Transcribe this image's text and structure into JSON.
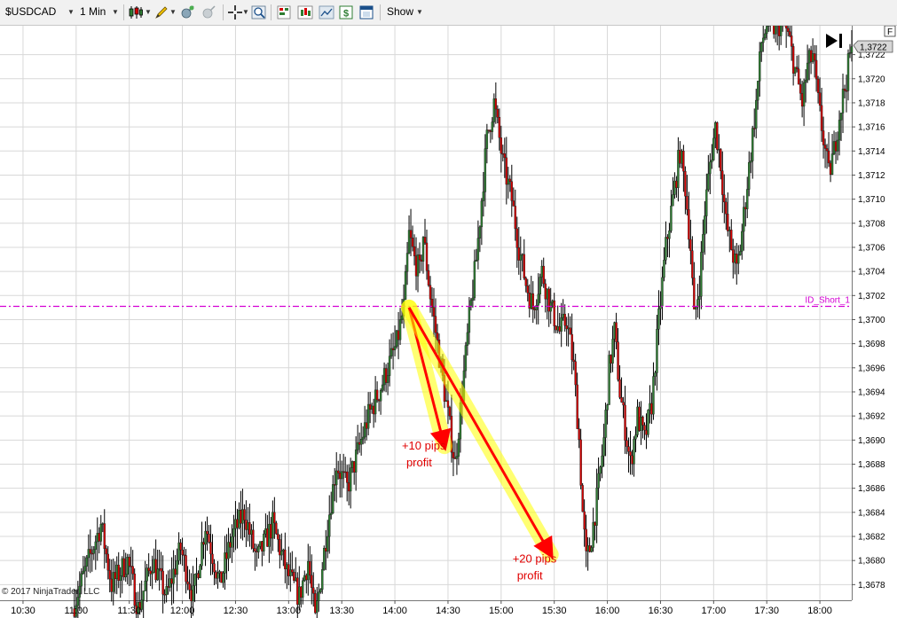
{
  "toolbar": {
    "instrument": "$USDCAD",
    "interval": "1 Min",
    "show_label": "Show",
    "icons": [
      "candlestick-style-icon",
      "pencil-draw-icon",
      "add-indicator-icon",
      "remove-indicator-icon",
      "crosshair-icon",
      "zoom-icon",
      "strategies-icon",
      "data-series-icon",
      "chart-properties-icon",
      "order-entry-icon",
      "window-icon"
    ]
  },
  "copyright": "© 2017 NinjaTrader, LLC",
  "price_marker": "1,3722",
  "corner_tag": "F",
  "colors": {
    "up_candle": "#2e7d32",
    "down_candle": "#d50000",
    "wick": "#000000",
    "level_line": "#d400d4",
    "highlight": "#ffff00",
    "arrow": "#ff0000",
    "annotation_text": "#e00000",
    "grid": "#d8d8d8"
  },
  "chart_data": {
    "type": "candlestick",
    "symbol": "$USDCAD",
    "timeframe": "1 Min",
    "x_tick_labels": [
      "10:30",
      "11:00",
      "11:30",
      "12:00",
      "12:30",
      "13:00",
      "13:30",
      "14:00",
      "14:30",
      "15:00",
      "15:30",
      "16:00",
      "16:30",
      "17:00",
      "17:30",
      "18:00"
    ],
    "y_tick_labels": [
      "1,3678",
      "1,3680",
      "1,3682",
      "1,3684",
      "1,3686",
      "1,3688",
      "1,3690",
      "1,3692",
      "1,3694",
      "1,3696",
      "1,3698",
      "1,3700",
      "1,3702",
      "1,3704",
      "1,3706",
      "1,3708",
      "1,3710",
      "1,3712",
      "1,3714",
      "1,3716",
      "1,3718",
      "1,3720",
      "1,3722"
    ],
    "ylim": [
      1.36767,
      1.37244
    ],
    "x_range_minutes": [
      617,
      1098
    ],
    "grid": true,
    "last_price": 1.3722,
    "level_line": {
      "label": "ID_Short_1",
      "price": 1.37011
    },
    "annotations": [
      {
        "text": [
          "+10 pips",
          "profit"
        ],
        "from": {
          "time": "14:08",
          "price": 1.3701
        },
        "to": {
          "time": "14:28",
          "price": 1.36895
        }
      },
      {
        "text": [
          "+20 pips",
          "profit"
        ],
        "from": {
          "time": "14:08",
          "price": 1.3701
        },
        "to": {
          "time": "15:28",
          "price": 1.36805
        }
      }
    ],
    "price_path": [
      [
        659,
        1.3676
      ],
      [
        668,
        1.368
      ],
      [
        675,
        1.3683
      ],
      [
        681,
        1.3678
      ],
      [
        690,
        1.368
      ],
      [
        696,
        1.3676
      ],
      [
        704,
        1.368
      ],
      [
        712,
        1.3677
      ],
      [
        720,
        1.3681
      ],
      [
        727,
        1.3677
      ],
      [
        734,
        1.3683
      ],
      [
        742,
        1.3678
      ],
      [
        749,
        1.3682
      ],
      [
        756,
        1.3684
      ],
      [
        763,
        1.368
      ],
      [
        772,
        1.3683
      ],
      [
        780,
        1.3679
      ],
      [
        787,
        1.3677
      ],
      [
        792,
        1.368
      ],
      [
        796,
        1.3675
      ],
      [
        803,
        1.3683
      ],
      [
        808,
        1.3688
      ],
      [
        814,
        1.3686
      ],
      [
        820,
        1.3689
      ],
      [
        826,
        1.3692
      ],
      [
        832,
        1.3694
      ],
      [
        837,
        1.3696
      ],
      [
        842,
        1.3698
      ],
      [
        846,
        1.3701
      ],
      [
        849,
        1.3707
      ],
      [
        852,
        1.3705
      ],
      [
        855,
        1.3704
      ],
      [
        857,
        1.3707
      ],
      [
        861,
        1.3702
      ],
      [
        866,
        1.3697
      ],
      [
        872,
        1.3691
      ],
      [
        875,
        1.3688
      ],
      [
        879,
        1.3694
      ],
      [
        883,
        1.37
      ],
      [
        887,
        1.3705
      ],
      [
        890,
        1.371
      ],
      [
        893,
        1.3715
      ],
      [
        897,
        1.3718
      ],
      [
        902,
        1.3713
      ],
      [
        907,
        1.371
      ],
      [
        911,
        1.3706
      ],
      [
        915,
        1.3703
      ],
      [
        919,
        1.3701
      ],
      [
        924,
        1.3704
      ],
      [
        929,
        1.3701
      ],
      [
        934,
        1.3699
      ],
      [
        938,
        1.37
      ],
      [
        942,
        1.3696
      ],
      [
        945,
        1.369
      ],
      [
        947,
        1.3684
      ],
      [
        949,
        1.368
      ],
      [
        951,
        1.3681
      ],
      [
        955,
        1.3685
      ],
      [
        959,
        1.369
      ],
      [
        962,
        1.3696
      ],
      [
        965,
        1.3699
      ],
      [
        968,
        1.3694
      ],
      [
        971,
        1.3691
      ],
      [
        974,
        1.3688
      ],
      [
        978,
        1.3692
      ],
      [
        982,
        1.369
      ],
      [
        986,
        1.3693
      ],
      [
        990,
        1.37
      ],
      [
        994,
        1.3706
      ],
      [
        998,
        1.371
      ],
      [
        1002,
        1.3714
      ],
      [
        1005,
        1.3711
      ],
      [
        1008,
        1.3706
      ],
      [
        1010,
        1.37
      ],
      [
        1013,
        1.3703
      ],
      [
        1016,
        1.3709
      ],
      [
        1019,
        1.3713
      ],
      [
        1022,
        1.3716
      ],
      [
        1025,
        1.3713
      ],
      [
        1028,
        1.3708
      ],
      [
        1031,
        1.3706
      ],
      [
        1034,
        1.3704
      ],
      [
        1036,
        1.3706
      ],
      [
        1039,
        1.371
      ],
      [
        1042,
        1.3714
      ],
      [
        1045,
        1.3718
      ],
      [
        1048,
        1.3723
      ],
      [
        1052,
        1.3725
      ],
      [
        1056,
        1.3724
      ],
      [
        1060,
        1.3725
      ],
      [
        1064,
        1.3723
      ],
      [
        1068,
        1.372
      ],
      [
        1071,
        1.3718
      ],
      [
        1074,
        1.3721
      ],
      [
        1077,
        1.3722
      ],
      [
        1080,
        1.3718
      ],
      [
        1083,
        1.3715
      ],
      [
        1086,
        1.3712
      ],
      [
        1089,
        1.3714
      ],
      [
        1092,
        1.3717
      ],
      [
        1096,
        1.372
      ],
      [
        1098,
        1.3722
      ]
    ]
  }
}
